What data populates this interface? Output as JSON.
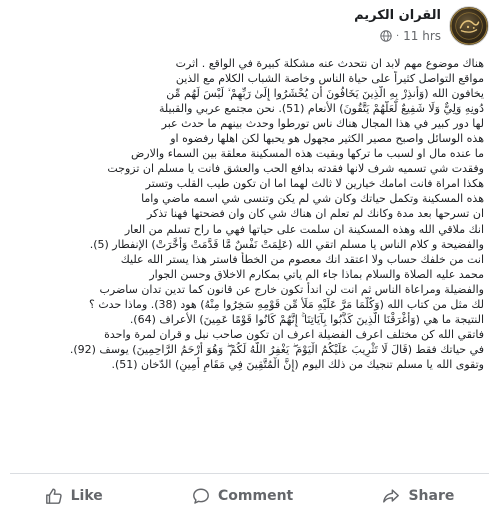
{
  "header": {
    "page_name": "القران الكريم",
    "timestamp": "11 hrs",
    "separator": "·",
    "audience_icon": "globe-icon"
  },
  "post": {
    "lines": [
      "هناك موضوع مهم لابد ان نتحدث عنه مشكلة كبيرة في الواقع . اثرت",
      "مواقع التواصل كثيراً على حياة الناس وخاصة الشباب الكلام مع الذين",
      "يخافون الله (وَأَنذِرْ بِهِ الَّذِينَ يَخَافُونَ أَن يُحْشَرُوا إِلَىٰ رَبِّهِمْ ۙ لَيْسَ لَهُم مِّن",
      "دُونِهِ وَلِيٌّ وَلَا شَفِيعٌ لَّعَلَّهُمْ يَتَّقُونَ) الأنعام (51). نحن مجتمع عربي والقبيلة",
      "لها دور كبير في هذا المجال هناك ناس تورطوا وحدث بينهم ما حدث عبر",
      "هذه الوسائل واصبح مصير الكثير مجهول هو يحبها لكن اهلها رفضوه او",
      "ما عنده مال او لسبب ما تركها وبقيت هذه المسكينة معلقة بين السماء والارض",
      "وفقدت شي تسميه شرف لانها فقدته بدافع الحب والعشق فانت يا مسلم ان تزوجت",
      "هكذا امراة فانت امامك خيارين لا ثالث لهما اما ان تكون طيب القلب وتستر",
      "هذه المسكينة وتكمل حياتك وكان شي لم يكن وتنسى شي اسمه ماضي واما",
      "ان تسرحها بعد مدة وكانك لم تعلم ان هناك شي كان وان فضحتها فهنا تذكر",
      "انك ملاقي الله وهذه المسكينة ان سلمت على حياتها فهي ما راح تسلم من العار",
      "والفضيحة و كلام الناس يا مسلم اتقي الله (عَلِمَتْ نَفْسٌ مَّا قَدَّمَتْ وَأَخَّرَتْ) الإنفطار (5).",
      "انت من خلفك حساب ولا اعتقد انك معصوم من الخطأ فاستر هذا يستر الله عليك",
      "محمد عليه الصلاة والسلام بماذا جاء الم ياتي بمكارم الاخلاق وحسن الجوار",
      "والفضيلة ومراعاة الناس ثم انت لن اندأ تكون خارج عن قانون كما تدين تدان ساضرب",
      "لك مثل من كتاب الله (وَكُلَّمَا مَرَّ عَلَيْهِ مَلَأٌ مِّن قَوْمِهِ سَخِرُوا مِنْهُ) هود (38). وماذا حدث ؟",
      "النتيجة ما هي (وَأَغْرَقْنَا الَّذِينَ كَذَّبُوا بِآيَاتِنَا ۚ إِنَّهُمْ كَانُوا قَوْمًا عَمِينَ) الأعراف (64).",
      "فاتقي الله كن مختلف اعرف الفضيلة اعرف ان تكون صاحب نبل و قران لمرة واحدة",
      "في حياتك فقط (قَالَ لَا تَثْرِيبَ عَلَيْكُمُ الْيَوْمَ ۖ يَغْفِرُ اللَّهُ لَكُمْ ۖ وَهُوَ أَرْحَمُ الرَّاحِمِينَ) يوسف (92).",
      "وتقوى الله يا مسلم تنجيك من ذلك اليوم (إِنَّ الْمُتَّقِينَ فِي مَقَامٍ أَمِينٍ) الدّخان (51)."
    ]
  },
  "actions": {
    "like_label": "Like",
    "comment_label": "Comment",
    "share_label": "Share",
    "like_icon": "thumbs-up-icon",
    "comment_icon": "comment-bubble-icon",
    "share_icon": "share-arrow-icon"
  },
  "colors": {
    "text": "#1c1e21",
    "secondary": "#65676b",
    "divider": "#dadde1"
  }
}
